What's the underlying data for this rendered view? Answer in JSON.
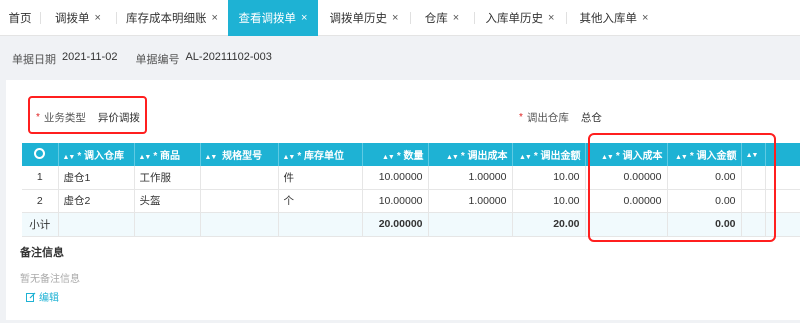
{
  "tabs": [
    {
      "label": "首页",
      "closable": false,
      "active": false
    },
    {
      "label": "调拨单",
      "closable": true,
      "active": false
    },
    {
      "label": "库存成本明细账",
      "closable": true,
      "active": false
    },
    {
      "label": "查看调拨单",
      "closable": true,
      "active": true
    },
    {
      "label": "调拨单历史",
      "closable": true,
      "active": false
    },
    {
      "label": "仓库",
      "closable": true,
      "active": false
    },
    {
      "label": "入库单历史",
      "closable": true,
      "active": false
    },
    {
      "label": "其他入库单",
      "closable": true,
      "active": false
    }
  ],
  "close_glyph": "×",
  "meta": {
    "date_label": "单据日期",
    "date_value": "2021-11-02",
    "no_label": "单据编号",
    "no_value": "AL-20211102-003"
  },
  "form": {
    "required_mark": "*",
    "biz_type_label": "业务类型",
    "biz_type_value": "异价调拨",
    "out_warehouse_label": "调出仓库",
    "out_warehouse_value": "总仓"
  },
  "table": {
    "headers": [
      "调入仓库",
      "商品",
      "规格型号",
      "库存单位",
      "数量",
      "调出成本",
      "调出金额",
      "调入成本",
      "调入金额"
    ],
    "rows": [
      {
        "idx": "1",
        "warehouse": "虚仓1",
        "product": "工作服",
        "spec": "",
        "unit": "件",
        "qty": "10.00000",
        "out_cost": "1.00000",
        "out_amount": "10.00",
        "in_cost": "0.00000",
        "in_amount": "0.00"
      },
      {
        "idx": "2",
        "warehouse": "虚仓2",
        "product": "头盔",
        "spec": "",
        "unit": "个",
        "qty": "10.00000",
        "out_cost": "1.00000",
        "out_amount": "10.00",
        "in_cost": "0.00000",
        "in_amount": "0.00"
      }
    ],
    "summary": {
      "label": "小计",
      "qty": "20.00000",
      "out_amount": "20.00",
      "in_amount": "0.00"
    }
  },
  "notes": {
    "title": "备注信息",
    "empty_text": "暂无备注信息",
    "edit_label": "编辑"
  },
  "colors": {
    "accent": "#1eb2d4",
    "highlight": "#ff1f1f",
    "required": "#e02020"
  }
}
